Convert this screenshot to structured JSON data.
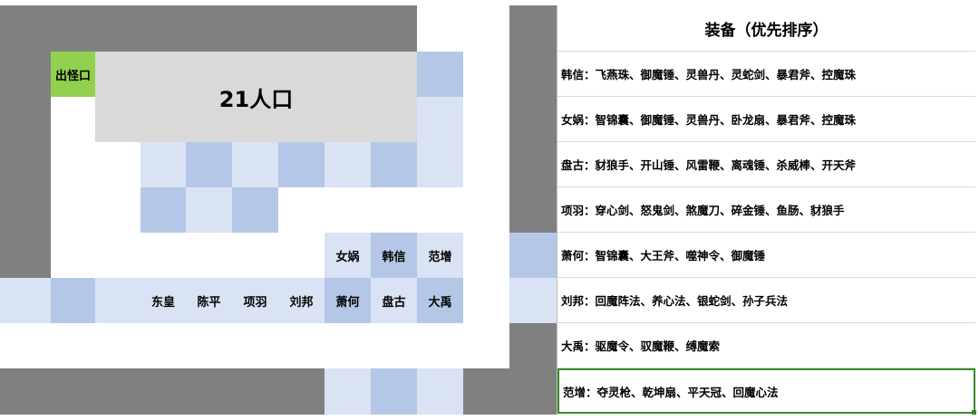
{
  "map": {
    "title": "21人口",
    "spawn_label": "出怪口",
    "heroes_row1": [
      "女娲",
      "韩信",
      "范增"
    ],
    "heroes_row2": [
      "东皇",
      "陈平",
      "项羽",
      "刘邦",
      "萧何",
      "盘古",
      "大禹"
    ]
  },
  "panel": {
    "title": "装备（优先排序）",
    "rows": [
      "韩信：飞燕珠、御魔锤、灵兽丹、灵蛇剑、暴君斧、控魔珠",
      "女娲：智锦囊、御魔锤、灵兽丹、卧龙扇、暴君斧、控魔珠",
      "盘古：豺狼手、开山锤、风雷鞭、离魂锤、杀威棒、开天斧",
      "项羽：穿心剑、怒鬼剑、煞魔刀、碎金锤、鱼肠、豺狼手",
      "萧何：智锦囊、大王斧、噬神令、御魔锤",
      "刘邦：回魔阵法、养心法、银蛇剑、孙子兵法",
      "大禹：驱魔令、驭魔鞭、缚魔索",
      "范增：夺灵枪、乾坤扇、平天冠、回魔心法"
    ]
  },
  "colors": {
    "gray": "#808080",
    "light_blue": "#dae3f3",
    "medium_blue": "#b4c7e7",
    "green": "#92d050",
    "silver": "#d9d9d9",
    "selection": "#3a8a2a"
  }
}
